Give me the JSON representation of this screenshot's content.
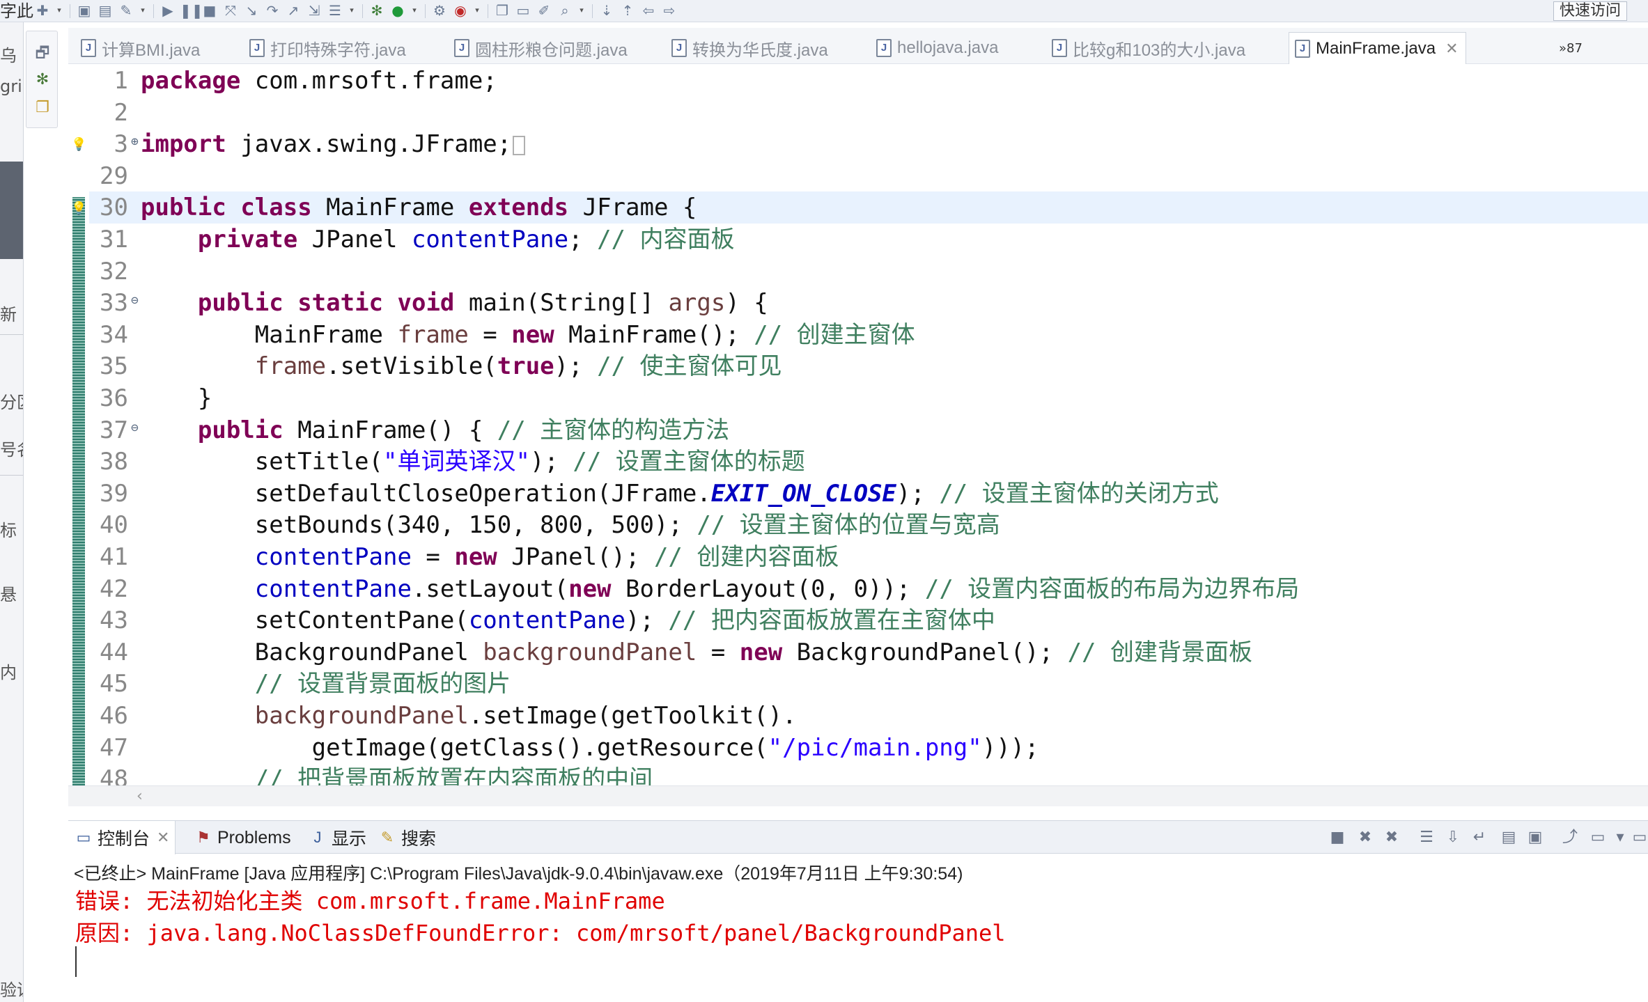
{
  "toolbar": {
    "left_cut_text": "字此",
    "quick_access": "快速访问",
    "icons": [
      "new-icon",
      "save-icon",
      "save-all-icon",
      "pin-icon",
      "resume-icon",
      "suspend-icon",
      "stop-icon",
      "disconnect-icon",
      "step-into-icon",
      "step-over-icon",
      "step-return-icon",
      "drop-frame-icon",
      "use-step-filters-icon",
      "debug-icon",
      "run-icon",
      "run-external-icon",
      "coverage-icon",
      "new-java-project-icon",
      "open-folder-icon",
      "open-task-icon",
      "search-icon",
      "next-annotation-icon",
      "prev-annotation-icon",
      "back-icon",
      "forward-icon"
    ]
  },
  "left_strip": {
    "texts": [
      "乌",
      "gri",
      "新",
      "分区",
      "号名",
      "标",
      "悬",
      "内",
      "验证"
    ]
  },
  "editor_tabs": [
    {
      "label": "计算BMI.java"
    },
    {
      "label": "打印特殊字符.java"
    },
    {
      "label": "圆柱形粮仓问题.java"
    },
    {
      "label": "转换为华氏度.java"
    },
    {
      "label": "hellojava.java"
    },
    {
      "label": "比较g和103的大小.java"
    },
    {
      "label": "MainFrame.java",
      "active": true
    }
  ],
  "tab_overflow": "»87",
  "code": {
    "lines": [
      {
        "n": "1",
        "segs": [
          [
            "kw",
            "package"
          ],
          [
            "p",
            " com.mrsoft.frame;"
          ]
        ]
      },
      {
        "n": "2",
        "segs": []
      },
      {
        "n": "3",
        "fold": "⊕",
        "segs": [
          [
            "kw",
            "import"
          ],
          [
            "p",
            " javax.swing.JFrame;"
          ]
        ]
      },
      {
        "n": "29",
        "segs": []
      },
      {
        "n": "30",
        "segs": [
          [
            "kw",
            "public"
          ],
          [
            "p",
            " "
          ],
          [
            "kw",
            "class"
          ],
          [
            "p",
            " MainFrame "
          ],
          [
            "kw",
            "extends"
          ],
          [
            "p",
            " JFrame {"
          ]
        ],
        "current": true
      },
      {
        "n": "31",
        "segs": [
          [
            "p",
            "    "
          ],
          [
            "kw",
            "private"
          ],
          [
            "p",
            " JPanel "
          ],
          [
            "fld",
            "contentPane"
          ],
          [
            "p",
            "; "
          ],
          [
            "cmt",
            "// 内容面板"
          ]
        ]
      },
      {
        "n": "32",
        "segs": []
      },
      {
        "n": "33",
        "fold": "⊖",
        "segs": [
          [
            "p",
            "    "
          ],
          [
            "kw",
            "public"
          ],
          [
            "p",
            " "
          ],
          [
            "kw",
            "static"
          ],
          [
            "p",
            " "
          ],
          [
            "kw",
            "void"
          ],
          [
            "p",
            " main(String[] "
          ],
          [
            "var",
            "args"
          ],
          [
            "p",
            ") {"
          ]
        ]
      },
      {
        "n": "34",
        "segs": [
          [
            "p",
            "        MainFrame "
          ],
          [
            "var",
            "frame"
          ],
          [
            "p",
            " = "
          ],
          [
            "kw",
            "new"
          ],
          [
            "p",
            " MainFrame(); "
          ],
          [
            "cmt",
            "// 创建主窗体"
          ]
        ]
      },
      {
        "n": "35",
        "segs": [
          [
            "p",
            "        "
          ],
          [
            "var",
            "frame"
          ],
          [
            "p",
            ".setVisible("
          ],
          [
            "kw",
            "true"
          ],
          [
            "p",
            "); "
          ],
          [
            "cmt",
            "// 使主窗体可见"
          ]
        ]
      },
      {
        "n": "36",
        "segs": [
          [
            "p",
            "    }"
          ]
        ]
      },
      {
        "n": "37",
        "fold": "⊖",
        "segs": [
          [
            "p",
            "    "
          ],
          [
            "kw",
            "public"
          ],
          [
            "p",
            " MainFrame() { "
          ],
          [
            "cmt",
            "// 主窗体的构造方法"
          ]
        ]
      },
      {
        "n": "38",
        "segs": [
          [
            "p",
            "        setTitle("
          ],
          [
            "str",
            "\"单词英译汉\""
          ],
          [
            "p",
            "); "
          ],
          [
            "cmt",
            "// 设置主窗体的标题"
          ]
        ]
      },
      {
        "n": "39",
        "segs": [
          [
            "p",
            "        setDefaultCloseOperation(JFrame."
          ],
          [
            "cst",
            "EXIT_ON_CLOSE"
          ],
          [
            "p",
            "); "
          ],
          [
            "cmt",
            "// 设置主窗体的关闭方式"
          ]
        ]
      },
      {
        "n": "40",
        "segs": [
          [
            "p",
            "        setBounds(340, 150, 800, 500); "
          ],
          [
            "cmt",
            "// 设置主窗体的位置与宽高"
          ]
        ]
      },
      {
        "n": "41",
        "segs": [
          [
            "p",
            "        "
          ],
          [
            "fld",
            "contentPane"
          ],
          [
            "p",
            " = "
          ],
          [
            "kw",
            "new"
          ],
          [
            "p",
            " JPanel(); "
          ],
          [
            "cmt",
            "// 创建内容面板"
          ]
        ]
      },
      {
        "n": "42",
        "segs": [
          [
            "p",
            "        "
          ],
          [
            "fld",
            "contentPane"
          ],
          [
            "p",
            ".setLayout("
          ],
          [
            "kw",
            "new"
          ],
          [
            "p",
            " BorderLayout(0, 0)); "
          ],
          [
            "cmt",
            "// 设置内容面板的布局为边界布局"
          ]
        ]
      },
      {
        "n": "43",
        "segs": [
          [
            "p",
            "        setContentPane("
          ],
          [
            "fld",
            "contentPane"
          ],
          [
            "p",
            "); "
          ],
          [
            "cmt",
            "// 把内容面板放置在主窗体中"
          ]
        ]
      },
      {
        "n": "44",
        "segs": [
          [
            "p",
            "        BackgroundPanel "
          ],
          [
            "var",
            "backgroundPanel"
          ],
          [
            "p",
            " = "
          ],
          [
            "kw",
            "new"
          ],
          [
            "p",
            " BackgroundPanel(); "
          ],
          [
            "cmt",
            "// 创建背景面板"
          ]
        ]
      },
      {
        "n": "45",
        "segs": [
          [
            "p",
            "        "
          ],
          [
            "cmt",
            "// 设置背景面板的图片"
          ]
        ]
      },
      {
        "n": "46",
        "segs": [
          [
            "p",
            "        "
          ],
          [
            "var",
            "backgroundPanel"
          ],
          [
            "p",
            ".setImage(getToolkit()."
          ]
        ]
      },
      {
        "n": "47",
        "segs": [
          [
            "p",
            "            getImage(getClass().getResource("
          ],
          [
            "str",
            "\"/pic/main.png\""
          ],
          [
            "p",
            ")));"
          ]
        ]
      },
      {
        "n": "48",
        "segs": [
          [
            "p",
            "        "
          ],
          [
            "cmt",
            "// 把背景面板放置在内容面板的中间"
          ]
        ]
      }
    ]
  },
  "view_tabs": [
    {
      "label": "控制台",
      "active": true
    },
    {
      "label": "Problems"
    },
    {
      "label": "显示"
    },
    {
      "label": "搜索"
    }
  ],
  "console": {
    "header": "<已终止> MainFrame [Java 应用程序] C:\\Program Files\\Java\\jdk-9.0.4\\bin\\javaw.exe（2019年7月11日 上午9:30:54)",
    "error_line_1": "错误: 无法初始化主类 com.mrsoft.frame.MainFrame",
    "error_line_2": "原因: java.lang.NoClassDefFoundError: com/mrsoft/panel/BackgroundPanel"
  }
}
